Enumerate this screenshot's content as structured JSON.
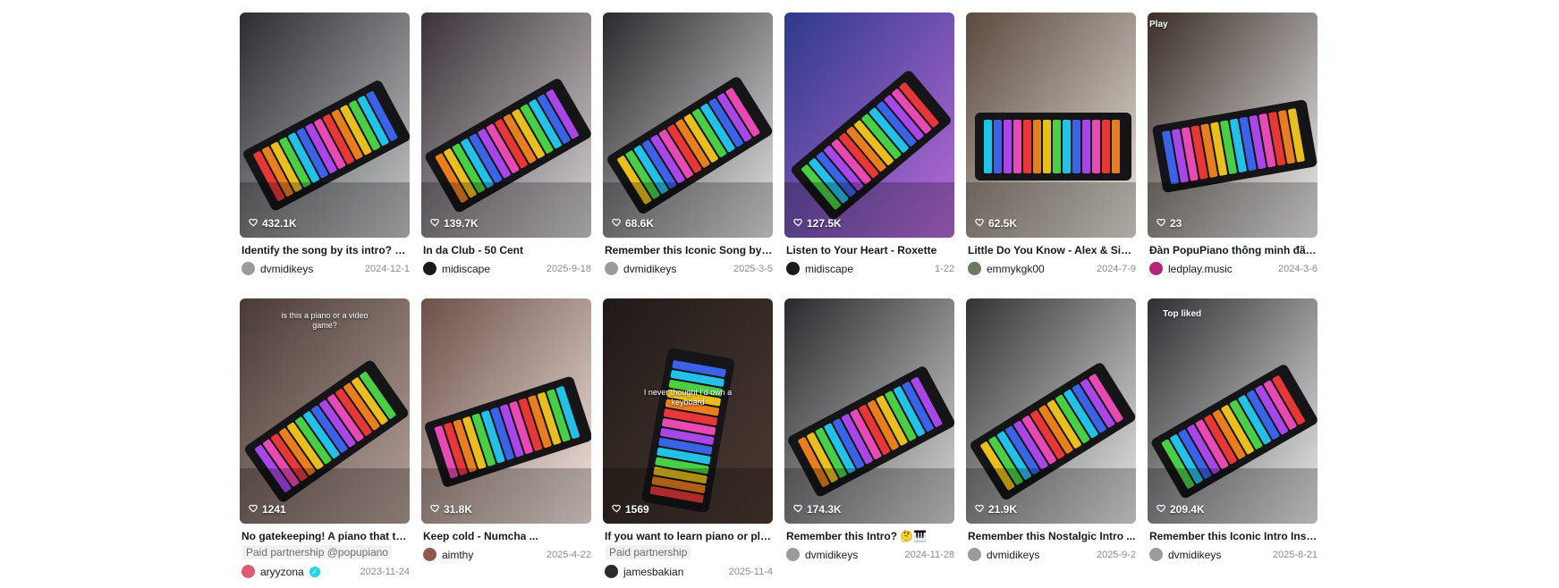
{
  "videos": [
    {
      "likes": "432.1K",
      "title": "Identify the song by its intro? 🤔 ...",
      "author": "dvmidikeys",
      "date": "2024-12-1",
      "avatar_color": "#9b9b9b",
      "bg": [
        "#2b2d33",
        "#c9c9c9"
      ]
    },
    {
      "likes": "139.7K",
      "title": "In da Club - 50 Cent",
      "author": "midiscape",
      "date": "2025-9-18",
      "avatar_color": "#1a1a1a",
      "bg": [
        "#3a3238",
        "#d6d2d6"
      ]
    },
    {
      "likes": "68.6K",
      "title": "Remember this Iconic Song by Y...",
      "author": "dvmidikeys",
      "date": "2025-3-5",
      "avatar_color": "#9b9b9b",
      "bg": [
        "#2a2a2e",
        "#e4e4e4"
      ]
    },
    {
      "likes": "127.5K",
      "title": "Listen to Your Heart - Roxette",
      "author": "midiscape",
      "date": "1-22",
      "avatar_color": "#1a1a1a",
      "bg": [
        "#2d3a8a",
        "#b96bd8"
      ]
    },
    {
      "likes": "62.5K",
      "title": "Little Do You Know - Alex & Sierr...",
      "author": "emmykgk00",
      "date": "2024-7-9",
      "avatar_color": "#6b7a5c",
      "bg": [
        "#5a4a3f",
        "#e8e3dc"
      ]
    },
    {
      "likes": "23",
      "title": "Đàn PopuPiano thông minh đã d...",
      "author": "ledplay.music",
      "date": "2024-3-6",
      "avatar_color": "#b3267a",
      "bg": [
        "#3b2f28",
        "#f0f0f0"
      ],
      "corner": "Play"
    },
    {
      "likes": "1241",
      "title": "No gatekeeping! A piano that te...",
      "partner": "Paid partnership @popupiano",
      "author": "aryyzona",
      "verified": true,
      "date": "2023-11-24",
      "avatar_color": "#e05a73",
      "bg": [
        "#4a3a36",
        "#b5a199"
      ],
      "overlay": "is this a piano or a video game?"
    },
    {
      "likes": "31.8K",
      "title": "Keep cold - Numcha ...",
      "author": "aimthy",
      "date": "2025-4-22",
      "avatar_color": "#8c5b4a",
      "bg": [
        "#6b5048",
        "#f3e5df"
      ]
    },
    {
      "likes": "1569",
      "title": "If you want to learn piano or play...",
      "partner": "Paid partnership",
      "author": "jamesbakian",
      "date": "2025-11-4",
      "avatar_color": "#2a2a2a",
      "bg": [
        "#1f1a18",
        "#4d3a33"
      ],
      "overlay": "I never thought I'd own a keyboard"
    },
    {
      "likes": "174.3K",
      "title": "Remember this Intro? 🤔🎹",
      "author": "dvmidikeys",
      "date": "2024-11-28",
      "avatar_color": "#9b9b9b",
      "bg": [
        "#2a2a2e",
        "#d8d8d8"
      ]
    },
    {
      "likes": "21.9K",
      "title": "Remember this Nostalgic Intro ...",
      "author": "dvmidikeys",
      "date": "2025-9-2",
      "avatar_color": "#9b9b9b",
      "bg": [
        "#333333",
        "#e9e9e9"
      ]
    },
    {
      "likes": "209.4K",
      "title": "Remember this Iconic Intro Instru...",
      "author": "dvmidikeys",
      "date": "2025-8-21",
      "avatar_color": "#9b9b9b",
      "bg": [
        "#2f2f33",
        "#ededed"
      ],
      "corner": "Top liked"
    }
  ]
}
